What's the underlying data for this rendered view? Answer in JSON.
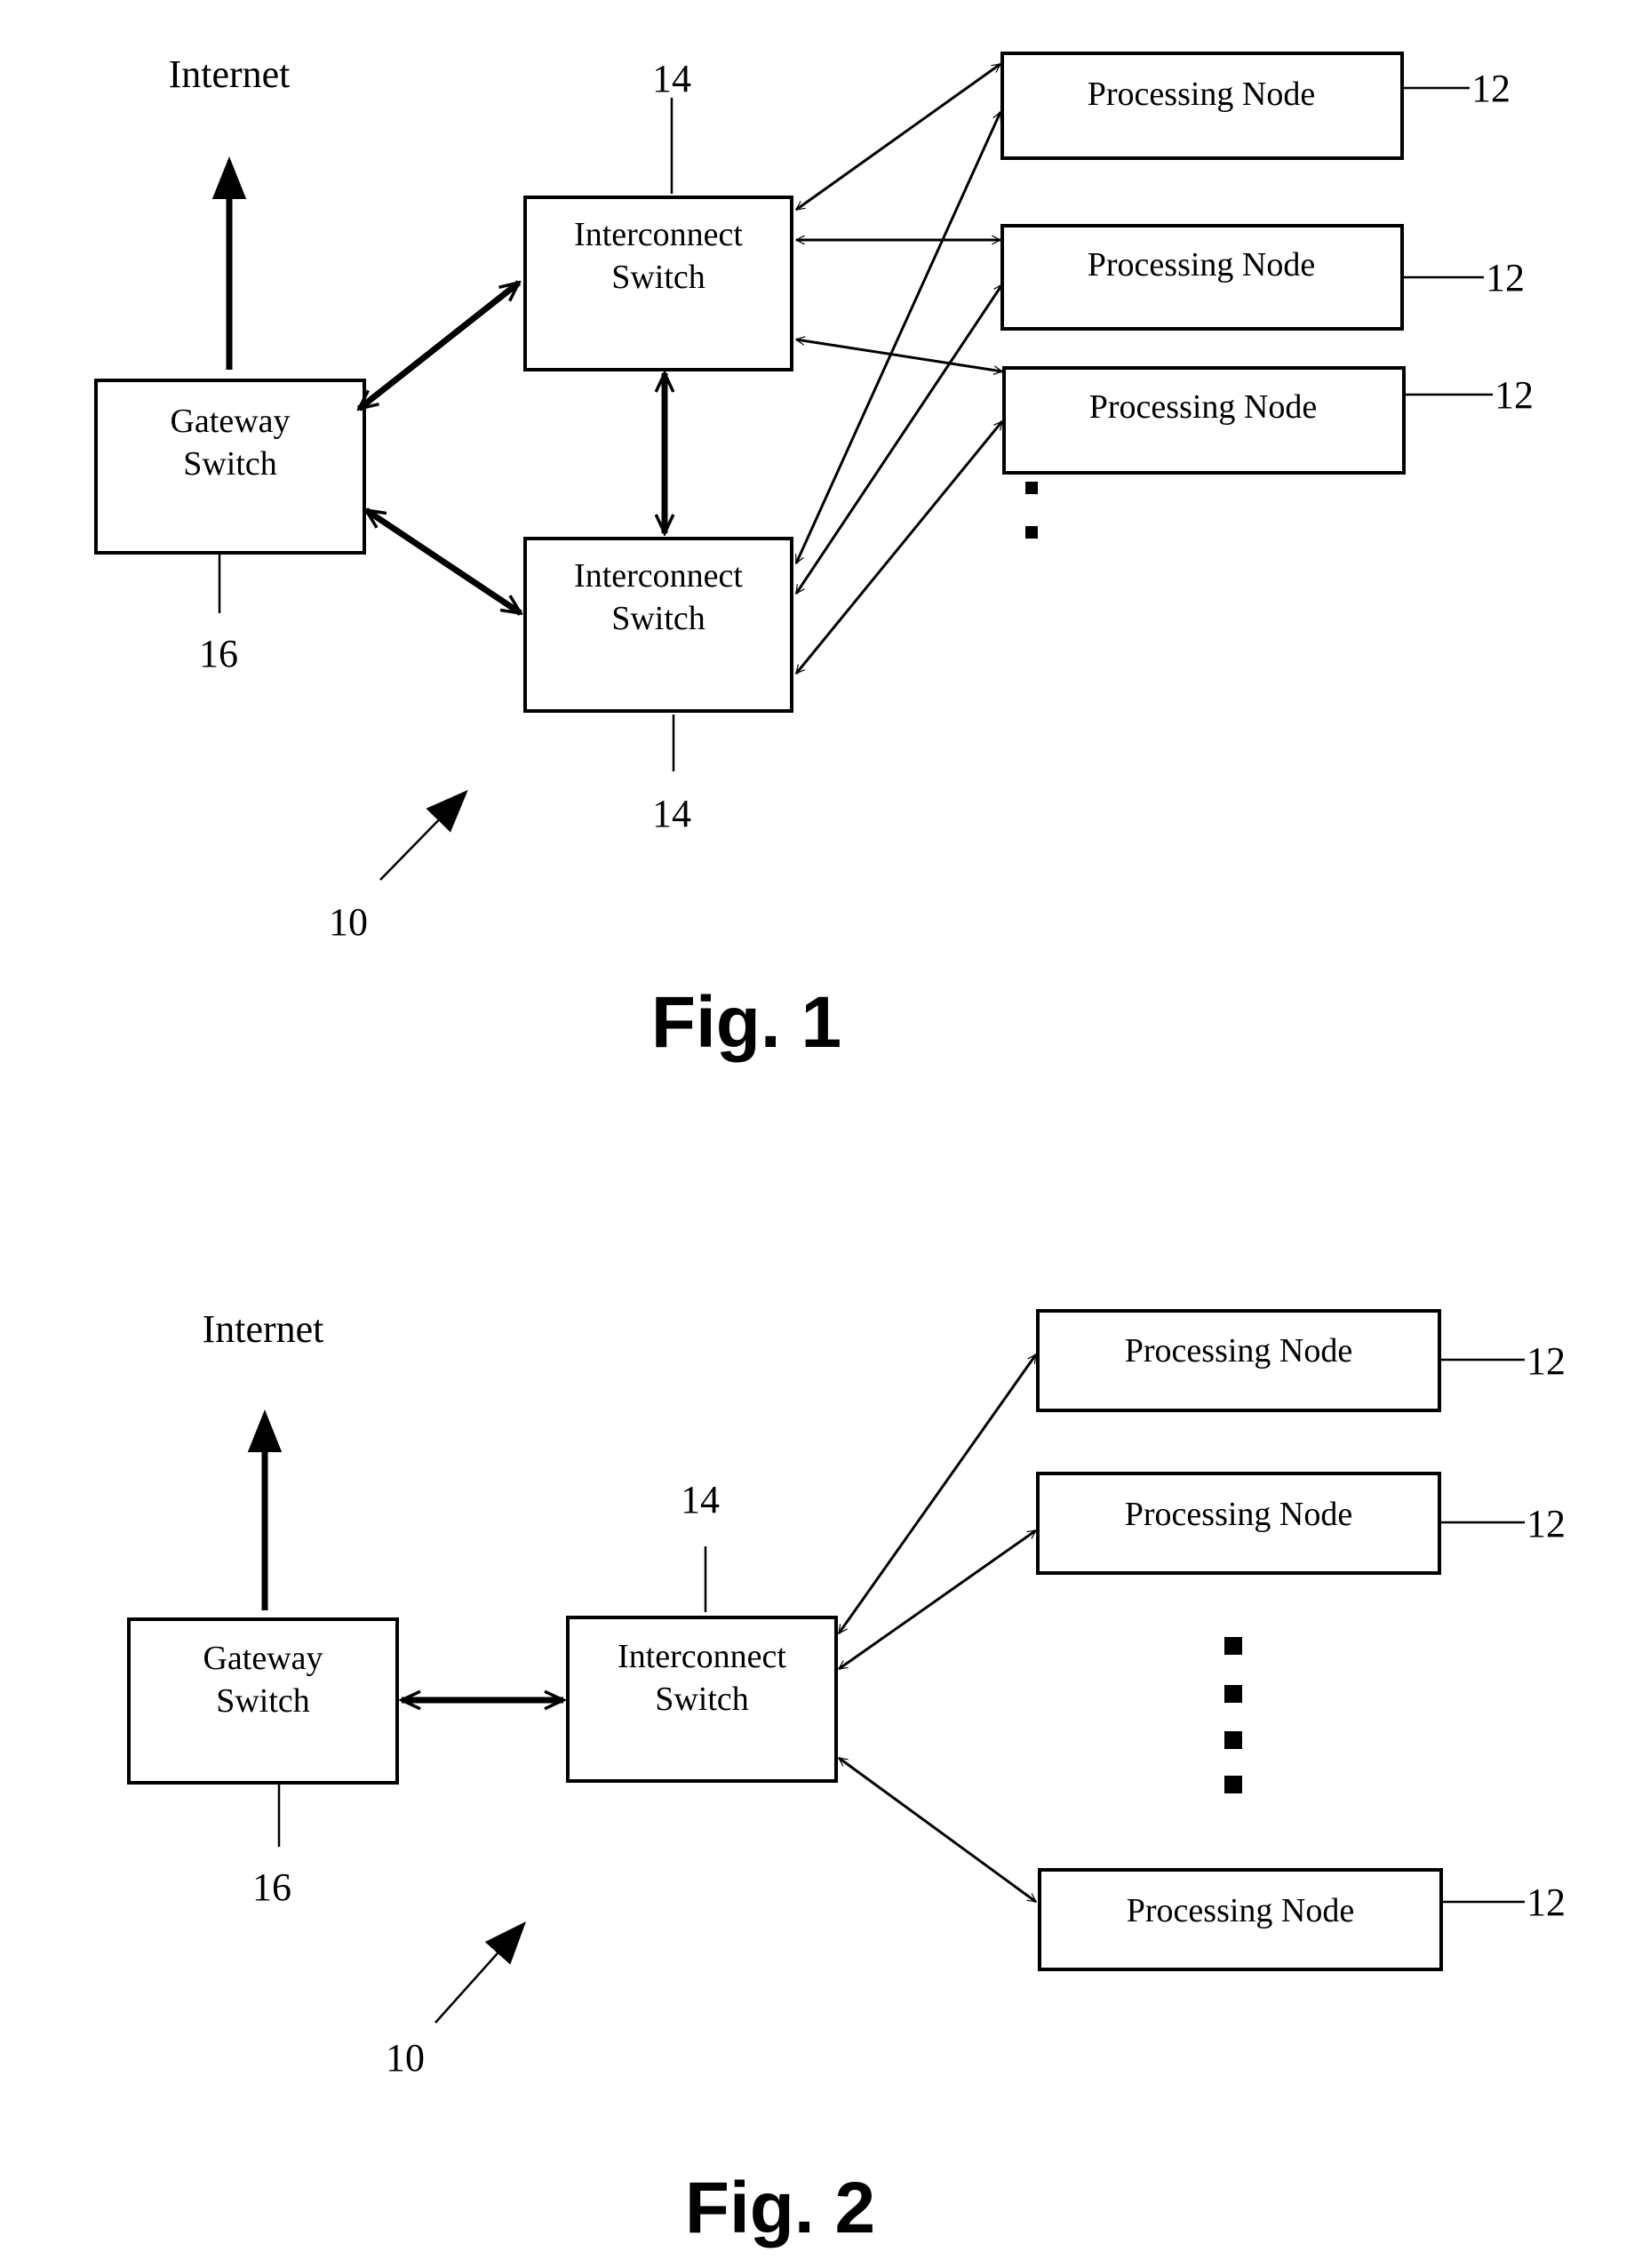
{
  "figures": [
    {
      "caption": "Fig. 1",
      "internet_label": "Internet",
      "gateway": {
        "line1": "Gateway",
        "line2": "Switch",
        "ref": "16"
      },
      "interconnects": [
        {
          "line1": "Interconnect",
          "line2": "Switch",
          "ref": "14"
        },
        {
          "line1": "Interconnect",
          "line2": "Switch",
          "ref": "14"
        }
      ],
      "nodes": [
        {
          "label": "Processing Node",
          "ref": "12"
        },
        {
          "label": "Processing Node",
          "ref": "12"
        },
        {
          "label": "Processing Node",
          "ref": "12"
        }
      ],
      "system_ref": "10"
    },
    {
      "caption": "Fig. 2",
      "internet_label": "Internet",
      "gateway": {
        "line1": "Gateway",
        "line2": "Switch",
        "ref": "16"
      },
      "interconnect": {
        "line1": "Interconnect",
        "line2": "Switch",
        "ref": "14"
      },
      "nodes": [
        {
          "label": "Processing Node",
          "ref": "12"
        },
        {
          "label": "Processing Node",
          "ref": "12"
        },
        {
          "label": "Processing Node",
          "ref": "12"
        }
      ],
      "system_ref": "10"
    }
  ]
}
